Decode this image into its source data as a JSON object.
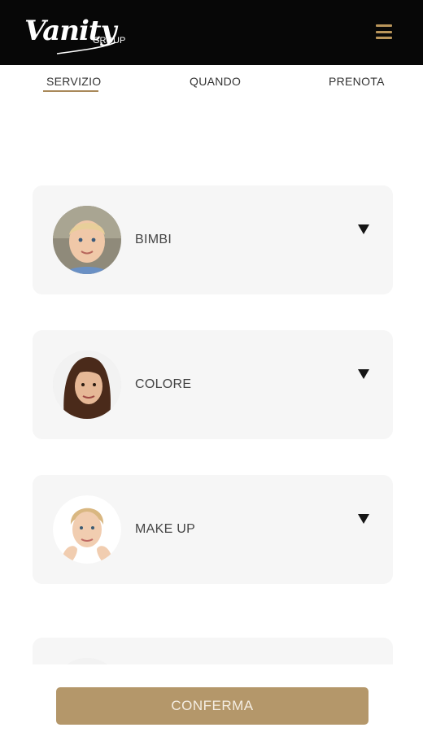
{
  "header": {
    "logo_script": "Vanity",
    "logo_suffix": "GROUP",
    "menu_icon": "hamburger-menu-icon",
    "accent_color": "#b9955a"
  },
  "tabs": [
    {
      "label": "SERVIZIO",
      "active": true
    },
    {
      "label": "QUANDO",
      "active": false
    },
    {
      "label": "PRENOTA",
      "active": false
    }
  ],
  "services": [
    {
      "label": "BIMBI",
      "image": "child-portrait",
      "icon": "chevron-down-icon"
    },
    {
      "label": "COLORE",
      "image": "woman-dark-hair-portrait",
      "icon": "chevron-down-icon"
    },
    {
      "label": "MAKE UP",
      "image": "woman-makeup-portrait",
      "icon": "chevron-down-icon"
    },
    {
      "label": "",
      "image": "woman-portrait",
      "icon": "chevron-down-icon"
    }
  ],
  "footer": {
    "confirm_label": "CONFERMA",
    "button_color": "#b4976a"
  }
}
